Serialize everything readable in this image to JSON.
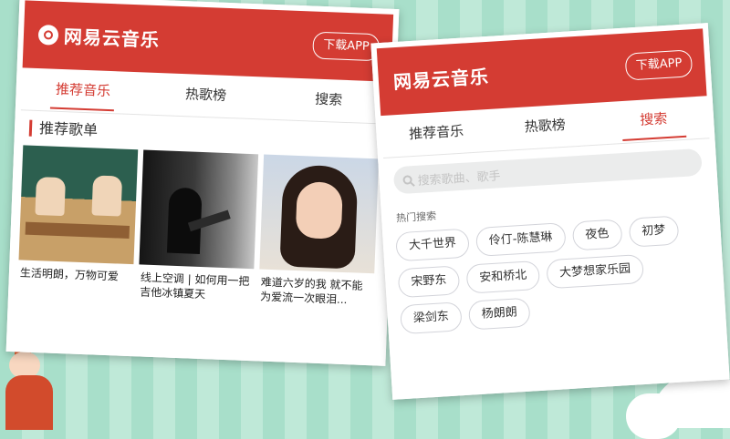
{
  "left_card": {
    "logo_text": "网易云音乐",
    "download_label": "下载APP",
    "tabs": [
      {
        "label": "推荐音乐",
        "active": true
      },
      {
        "label": "热歌榜",
        "active": false
      },
      {
        "label": "搜索",
        "active": false
      }
    ],
    "section_title": "推荐歌单",
    "playlists": [
      {
        "caption": "生活明朗，万物可爱"
      },
      {
        "caption": "线上空调 | 如何用一把吉他冰镇夏天"
      },
      {
        "caption": "难道六岁的我 就不能为爱流一次眼泪..."
      }
    ]
  },
  "right_card": {
    "logo_text": "网易云音乐",
    "download_label": "下载APP",
    "tabs": [
      {
        "label": "推荐音乐",
        "active": false
      },
      {
        "label": "热歌榜",
        "active": false
      },
      {
        "label": "搜索",
        "active": true
      }
    ],
    "search_placeholder": "搜索歌曲、歌手",
    "hot_search_title": "热门搜索",
    "hot_searches": [
      "大千世界",
      "伶仃-陈慧琳",
      "夜色",
      "初梦",
      "宋野东",
      "安和桥北",
      "大梦想家乐园",
      "梁剑东",
      "杨朗朗"
    ]
  },
  "colors": {
    "brand_red": "#d43c33",
    "background_mint": "#a8dfca"
  }
}
